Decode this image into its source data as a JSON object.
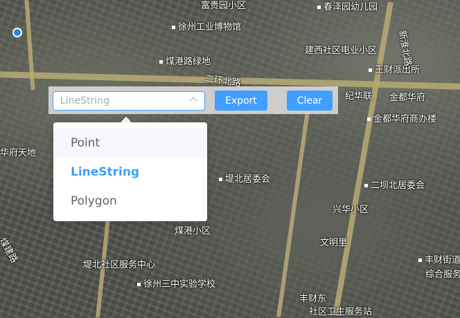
{
  "map": {
    "labels": [
      {
        "text": "富贵园小区",
        "poi": false
      },
      {
        "text": "春泽园幼儿园",
        "poi": true
      },
      {
        "text": "徐州工业博物馆",
        "poi": true
      },
      {
        "text": "煤港路绿地",
        "poi": true
      },
      {
        "text": "建西社区电业小区",
        "poi": false
      },
      {
        "text": "二环北路",
        "poi": false
      },
      {
        "text": "王财派出所",
        "poi": true
      },
      {
        "text": "纪华联",
        "poi": false
      },
      {
        "text": "金都华府",
        "poi": false
      },
      {
        "text": "金都华府商办楼",
        "poi": true
      },
      {
        "text": "华府天地",
        "poi": false
      },
      {
        "text": "堤北居委会",
        "poi": true
      },
      {
        "text": "二坝北居委会",
        "poi": true
      },
      {
        "text": "兴华小区",
        "poi": false
      },
      {
        "text": "煤港小区",
        "poi": false
      },
      {
        "text": "文明里",
        "poi": false
      },
      {
        "text": "堤北社区服务中心",
        "poi": false
      },
      {
        "text": "徐州三中实验学校",
        "poi": true
      },
      {
        "text": "丰财街道",
        "poi": true
      },
      {
        "text": "综合服务",
        "poi": false
      },
      {
        "text": "丰财东",
        "poi": false
      },
      {
        "text": "社区卫生服务站",
        "poi": false
      },
      {
        "text": "新淮北路",
        "poi": false
      },
      {
        "text": "煤建路",
        "poi": false
      }
    ],
    "colors": {
      "accent": "#409eff",
      "location": "#1e88e5"
    }
  },
  "toolbar": {
    "select_value": "LineString",
    "export_label": "Export",
    "clear_label": "Clear"
  },
  "dropdown": {
    "options": [
      "Point",
      "LineString",
      "Polygon"
    ],
    "selected": "LineString",
    "hovered": "Point"
  }
}
